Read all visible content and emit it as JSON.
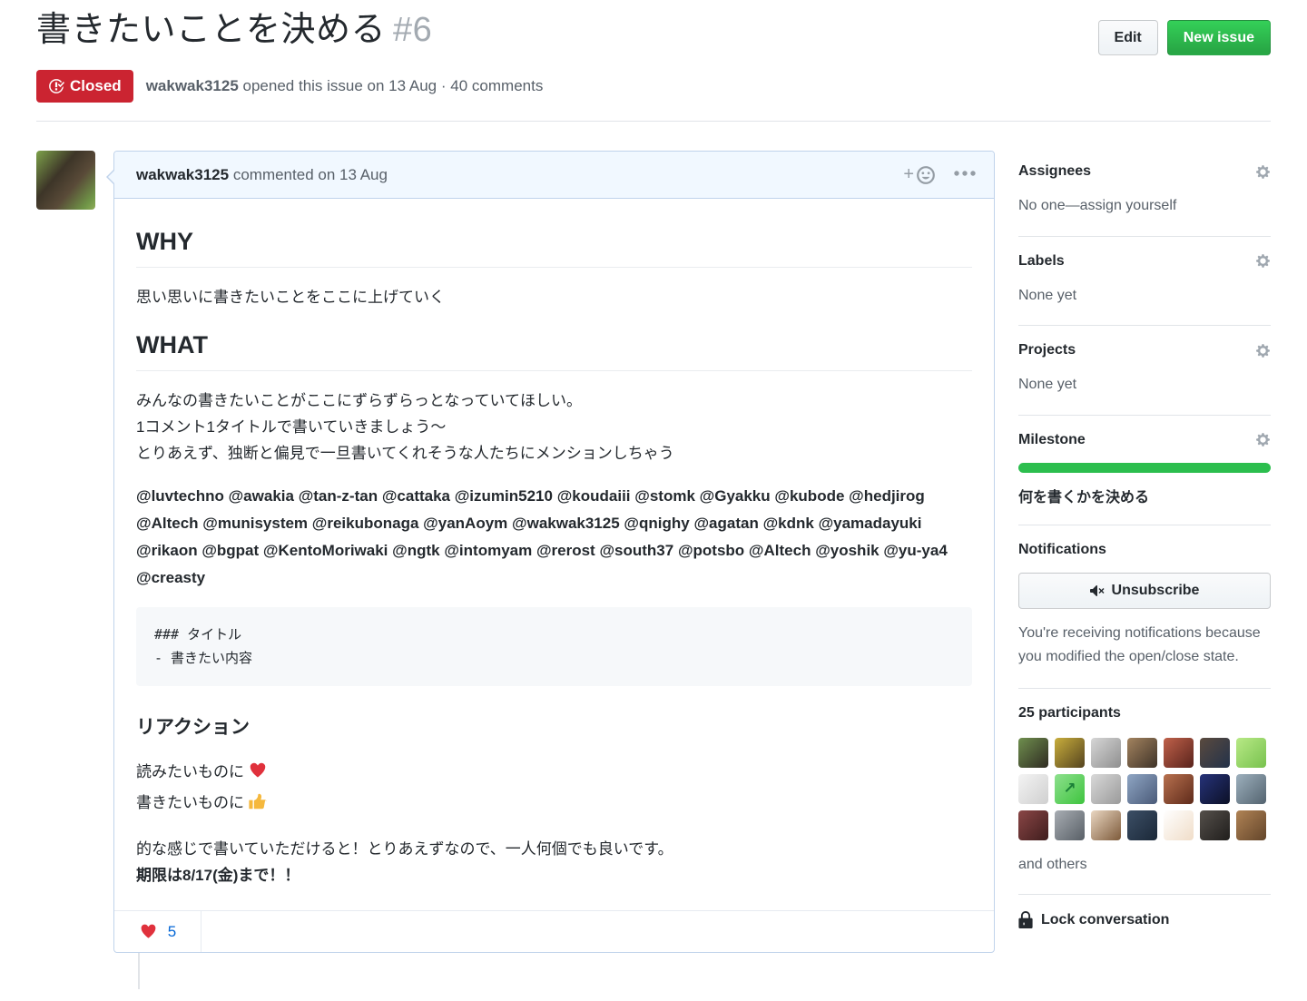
{
  "colors": {
    "closed_badge": "#cb2431",
    "new_issue_green": "#28a745",
    "link_blue": "#0366d6",
    "comment_header_bg": "#f1f8ff",
    "comment_border": "#c0d3eb",
    "milestone_green": "#2cbe4e",
    "divider": "#e1e4e8"
  },
  "icons": {
    "issue_closed": "issue-closed-icon",
    "smiley": "smiley-icon",
    "kebab": "kebab-icon",
    "gear": "gear-icon",
    "mute": "mute-icon",
    "lock": "lock-icon",
    "heart": "heart-emoji",
    "thumbs_up": "thumbsup-emoji"
  },
  "issue_header": {
    "title": "書きたいことを決める",
    "number": "#6",
    "edit_label": "Edit",
    "new_issue_label": "New issue",
    "status_label": "Closed",
    "meta": {
      "author": "wakwak3125",
      "action": "opened this issue on 13 Aug",
      "separator": "·",
      "comments": "40 comments"
    }
  },
  "comment": {
    "author": "wakwak3125",
    "header_rest": "commented on 13 Aug",
    "body": {
      "h2_why": "WHY",
      "why_text": "思い思いに書きたいことをここに上げていく",
      "h2_what": "WHAT",
      "what_text": "みんなの書きたいことがここにずらずらっとなっていてほしい。\n1コメント1タイトルで書いていきましょう〜\nとりあえず、独断と偏見で一旦書いてくれそうな人たちにメンションしちゃう",
      "mentions": [
        "@luvtechno",
        "@awakia",
        "@tan-z-tan",
        "@cattaka",
        "@izumin5210",
        "@koudaiii",
        "@stomk",
        "@Gyakku",
        "@kubode",
        "@hedjirog",
        "@Altech",
        "@munisystem",
        "@reikubonaga",
        "@yanAoym",
        "@wakwak3125",
        "@qnighy",
        "@agatan",
        "@kdnk",
        "@yamadayuki",
        "@rikaon",
        "@bgpat",
        "@KentoMoriwaki",
        "@ngtk",
        "@intomyam",
        "@rerost",
        "@south37",
        "@potsbo",
        "@Altech",
        "@yoshik",
        "@yu-ya4",
        "@creasty"
      ],
      "code_block": "### タイトル\n- 書きたい内容",
      "h3_reaction": "リアクション",
      "read_line": "読みたいものに",
      "write_line": "書きたいものに",
      "closing_text": "的な感じで書いていただけると！とりあえずなので、一人何個でも良いです。",
      "deadline_text": "期限は8/17(金)まで！！"
    },
    "reactions": {
      "heart_count": "5"
    }
  },
  "sidebar": {
    "assignees": {
      "title": "Assignees",
      "value": "No one—assign yourself"
    },
    "labels": {
      "title": "Labels",
      "value": "None yet"
    },
    "projects": {
      "title": "Projects",
      "value": "None yet"
    },
    "milestone": {
      "title": "Milestone",
      "progress_percent": 100,
      "name": "何を書くかを決める"
    },
    "notifications": {
      "title": "Notifications",
      "button_label": "Unsubscribe",
      "description": "You're receiving notifications because you modified the open/close state."
    },
    "participants": {
      "title": "25 participants",
      "count": 25,
      "and_others": "and others",
      "avatars": [
        {
          "c1": "#6f8f4e",
          "c2": "#2f2b22"
        },
        {
          "c1": "#c9ae3c",
          "c2": "#54431f"
        },
        {
          "c1": "#d6d6d6",
          "c2": "#8f8f8f"
        },
        {
          "c1": "#a3835f",
          "c2": "#3f3328"
        },
        {
          "c1": "#c0614a",
          "c2": "#59231c"
        },
        {
          "c1": "#5a4a3e",
          "c2": "#23324a"
        },
        {
          "c1": "#b8e986",
          "c2": "#78c24e"
        },
        {
          "c1": "#f4f4f4",
          "c2": "#cfcfcf"
        },
        {
          "c1": "#8ee08e",
          "c2": "#3ec43e",
          "glyph": "↗"
        },
        {
          "c1": "#d9d9d9",
          "c2": "#9a9a9a"
        },
        {
          "c1": "#8fa6c4",
          "c2": "#4a5a78"
        },
        {
          "c1": "#b8714f",
          "c2": "#5e2a1a"
        },
        {
          "c1": "#26337a",
          "c2": "#0c1026"
        },
        {
          "c1": "#9db0bd",
          "c2": "#53636f"
        },
        {
          "c1": "#8a4646",
          "c2": "#3f1d1d"
        },
        {
          "c1": "#a8adb3",
          "c2": "#585f66"
        },
        {
          "c1": "#ead7c2",
          "c2": "#7d5a3a"
        },
        {
          "c1": "#3c4f66",
          "c2": "#1b2838"
        },
        {
          "c1": "#ffffff",
          "c2": "#f0ddc8"
        },
        {
          "c1": "#55504b",
          "c2": "#201e1c"
        },
        {
          "c1": "#b08355",
          "c2": "#63452a"
        }
      ]
    },
    "lock": {
      "label": "Lock conversation"
    }
  }
}
